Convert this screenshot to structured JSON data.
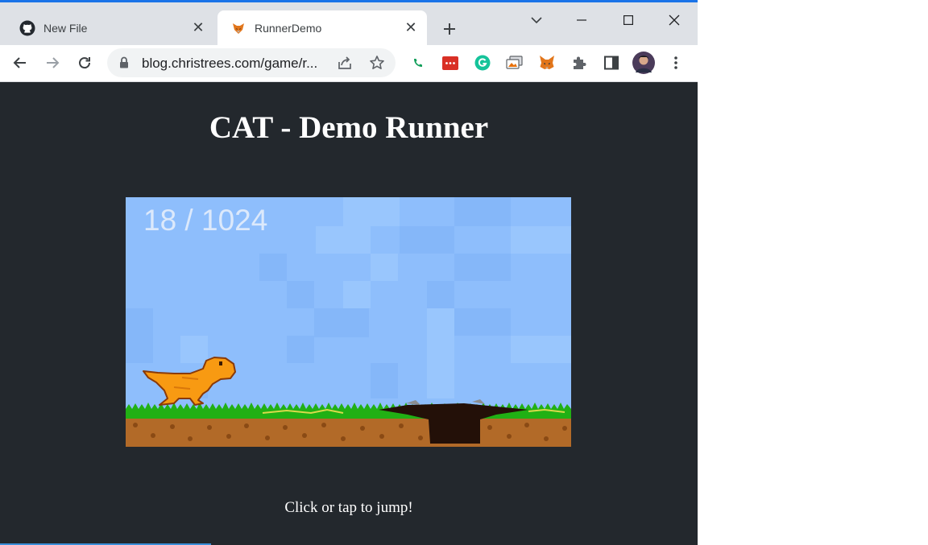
{
  "browser": {
    "tabs": [
      {
        "title": "New File",
        "icon": "github-icon"
      },
      {
        "title": "RunnerDemo",
        "icon": "fox-icon"
      }
    ],
    "url": "blog.christrees.com/game/r...",
    "accent_color": "#1a73e8"
  },
  "page": {
    "title": "CAT - Demo Runner",
    "instructions": "Click or tap to jump!",
    "background": "#23282d"
  },
  "game": {
    "score": "18 / 1024",
    "sky_color": "#8ebefc",
    "grass_color": "#21b014",
    "dirt_color": "#b26a28",
    "character_color": "#f89a12"
  }
}
